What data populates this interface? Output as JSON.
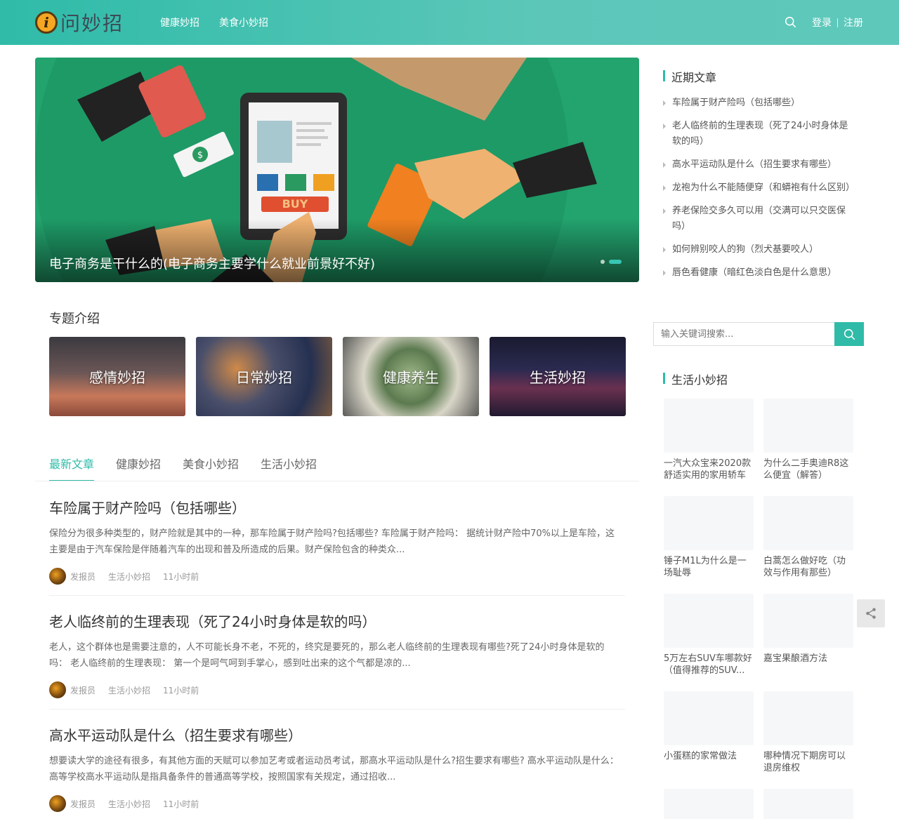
{
  "header": {
    "logo_text": "问妙招",
    "logo_glyph": "i",
    "nav": [
      "健康妙招",
      "美食小妙招"
    ],
    "login": "登录",
    "register": "注册"
  },
  "slider": {
    "caption": "电子商务是干什么的(电子商务主要学什么就业前景好不好)",
    "buy_label": "BUY",
    "money_symbol": "$"
  },
  "topics": {
    "title": "专题介绍",
    "items": [
      "感情妙招",
      "日常妙招",
      "健康养生",
      "生活妙招"
    ]
  },
  "tabs": [
    "最新文章",
    "健康妙招",
    "美食小妙招",
    "生活小妙招"
  ],
  "articles": [
    {
      "title": "车险属于财产险吗（包括哪些）",
      "summary": "保险分为很多种类型的，财产险就是其中的一种，那车险属于财产险吗?包括哪些? 车险属于财产险吗： 据统计财产险中70%以上是车险，这主要是由于汽车保险是伴随着汽车的出现和普及所造成的后果。财产保险包含的种类众...",
      "author": "发报员",
      "category": "生活小妙招",
      "time": "11小时前"
    },
    {
      "title": "老人临终前的生理表现（死了24小时身体是软的吗）",
      "summary": "老人，这个群体也是需要注意的，人不可能长身不老，不死的，终究是要死的，那么老人临终前的生理表现有哪些?死了24小时身体是软的吗： 老人临终前的生理表现： 第一个是呵气呵到手掌心，感到吐出来的这个气都是凉的...",
      "author": "发报员",
      "category": "生活小妙招",
      "time": "11小时前"
    },
    {
      "title": "高水平运动队是什么（招生要求有哪些）",
      "summary": "想要读大学的途径有很多，有其他方面的天赋可以参加艺考或者运动员考试，那高水平运动队是什么?招生要求有哪些? 高水平运动队是什么： 高等学校高水平运动队是指具备条件的普通高等学校，按照国家有关规定，通过招收...",
      "author": "发报员",
      "category": "生活小妙招",
      "time": "11小时前"
    }
  ],
  "sidebar": {
    "recent_title": "近期文章",
    "recent": [
      "车险属于财产险吗（包括哪些）",
      "老人临终前的生理表现（死了24小时身体是软的吗）",
      "高水平运动队是什么（招生要求有哪些）",
      "龙袍为什么不能随便穿（和蟒袍有什么区别）",
      "养老保险交多久可以用（交满可以只交医保吗）",
      "如何辨别咬人的狗（烈犬基要咬人）",
      "唇色看健康（暗红色淡白色是什么意思）"
    ],
    "search_placeholder": "输入关键词搜索...",
    "life_title": "生活小妙招",
    "life_items": [
      "一汽大众宝来2020款舒适实用的家用轿车",
      "为什么二手奥迪R8这么便宜（解答）",
      "锤子M1L为什么是一场耻辱",
      "白蒿怎么做好吃（功效与作用有那些）",
      "5万左右SUV车哪款好（值得推荐的SUV...",
      "嘉宝果酿酒方法",
      "小蛋糕的家常做法",
      "哪种情况下期房可以退房维权"
    ]
  },
  "colors": {
    "accent": "#2fbba8",
    "header_gradient_end": "#5ec8bb"
  },
  "icons": {
    "search": "search-icon",
    "share": "share-icon"
  }
}
